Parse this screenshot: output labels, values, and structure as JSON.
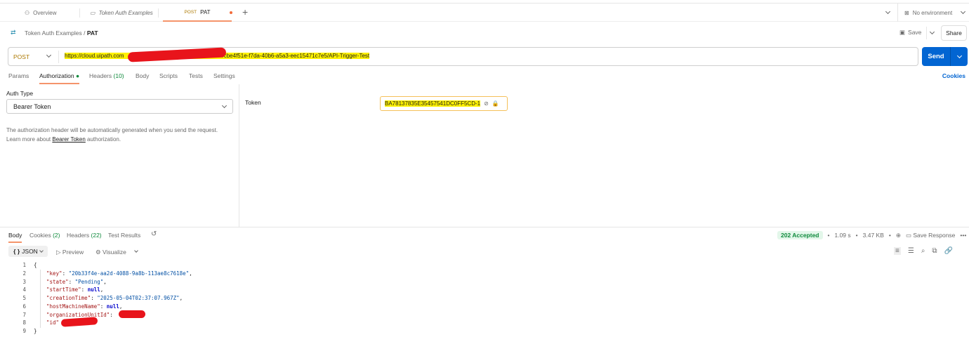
{
  "tabs": [
    {
      "label": "Overview",
      "icon": "overview-icon"
    },
    {
      "label": "Token Auth Examples",
      "icon": "collection-icon"
    },
    {
      "method": "POST",
      "label": "PAT",
      "active": true
    }
  ],
  "environment": "No environment",
  "breadcrumb": {
    "collection": "Token Auth Examples",
    "separator": "/",
    "request": "PAT"
  },
  "actions": {
    "save": "Save",
    "share": "Share"
  },
  "request": {
    "method": "POST",
    "url_start": "https://cloud.uipath.com",
    "url_end": "/cbe4f51e-f7da-40b6-a5a3-eec15471c7e5/API-Trigger-Test",
    "send": "Send"
  },
  "request_tabs": [
    {
      "label": "Params"
    },
    {
      "label": "Authorization",
      "active": true
    },
    {
      "label": "Headers",
      "count": "(10)"
    },
    {
      "label": "Body"
    },
    {
      "label": "Scripts"
    },
    {
      "label": "Tests"
    },
    {
      "label": "Settings"
    }
  ],
  "cookies_link": "Cookies",
  "auth": {
    "type_label": "Auth Type",
    "type_value": "Bearer Token",
    "help_1": "The authorization header will be automatically generated when you send the request.",
    "help_2_prefix": "Learn more about ",
    "help_link": "Bearer Token",
    "help_2_suffix": " authorization.",
    "token_label": "Token",
    "token_value": "BA78137835E35457541DC0FF5CD-1"
  },
  "response_tabs": [
    {
      "label": "Body",
      "active": true
    },
    {
      "label": "Cookies",
      "count": "(2)"
    },
    {
      "label": "Headers",
      "count": "(22)"
    },
    {
      "label": "Test Results"
    }
  ],
  "status": {
    "code": "202 Accepted",
    "time": "1.09 s",
    "size": "3.47 KB",
    "save_response": "Save Response",
    "color": "#0f8a3c"
  },
  "body_toolbar": {
    "format": "JSON",
    "preview": "Preview",
    "visualize": "Visualize"
  },
  "code_lines": [
    {
      "n": "1",
      "parts": [
        [
          "p",
          "{"
        ]
      ]
    },
    {
      "n": "2",
      "parts": [
        [
          "k",
          "\"key\""
        ],
        [
          "p",
          ": "
        ],
        [
          "s",
          "\"20b33f4e-aa2d-4088-9a8b-113ae8c7618e\""
        ],
        [
          "p",
          ","
        ]
      ]
    },
    {
      "n": "3",
      "parts": [
        [
          "k",
          "\"state\""
        ],
        [
          "p",
          ": "
        ],
        [
          "s",
          "\"Pending\""
        ],
        [
          "p",
          ","
        ]
      ]
    },
    {
      "n": "4",
      "parts": [
        [
          "k",
          "\"startTime\""
        ],
        [
          "p",
          ": "
        ],
        [
          "n",
          "null"
        ],
        [
          "p",
          ","
        ]
      ]
    },
    {
      "n": "5",
      "parts": [
        [
          "k",
          "\"creationTime\""
        ],
        [
          "p",
          ": "
        ],
        [
          "s",
          "\"2025-05-04T02:37:07.967Z\""
        ],
        [
          "p",
          ","
        ]
      ]
    },
    {
      "n": "6",
      "parts": [
        [
          "k",
          "\"hostMachineName\""
        ],
        [
          "p",
          ": "
        ],
        [
          "n",
          "null"
        ],
        [
          "p",
          ","
        ]
      ]
    },
    {
      "n": "7",
      "parts": [
        [
          "k",
          "\"organizationUnitId\""
        ],
        [
          "p",
          ": "
        ]
      ]
    },
    {
      "n": "8",
      "parts": [
        [
          "k",
          "\"id\""
        ]
      ]
    },
    {
      "n": "9",
      "parts": [
        [
          "p",
          "}"
        ]
      ]
    }
  ]
}
